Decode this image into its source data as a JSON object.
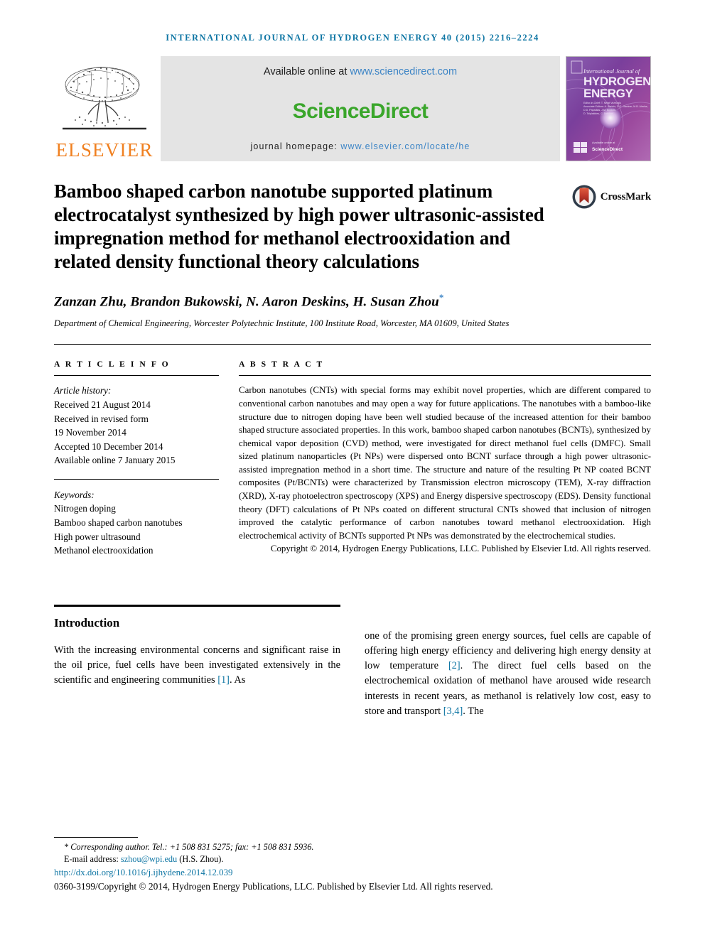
{
  "running_head": "INTERNATIONAL JOURNAL OF HYDROGEN ENERGY 40 (2015) 2216–2224",
  "masthead": {
    "publisher_name": "ELSEVIER",
    "available_prefix": "Available online at ",
    "available_link": "www.sciencedirect.com",
    "sciencedirect_word": "ScienceDirect",
    "homepage_prefix": "journal homepage: ",
    "homepage_link": "www.elsevier.com/locate/he",
    "cover": {
      "line1": "International Journal of",
      "line2": "HYDROGEN",
      "line3": "ENERGY",
      "editors_block": "Editor-in-Chief: T. Nejat Veziroglu\nAssociate Editors: A. Bartels, D.C. Gardner, M.B. Alecha,\nD.D. Papadias, J.M. Bockris,\nD. Tsiplakides, C. Dutcher",
      "footer_brand": "ScienceDirect"
    }
  },
  "crossmark": {
    "label": "CrossMark"
  },
  "article": {
    "title": "Bamboo shaped carbon nanotube supported platinum electrocatalyst synthesized by high power ultrasonic-assisted impregnation method for methanol electrooxidation and related density functional theory calculations",
    "authors": "Zanzan Zhu, Brandon Bukowski, N. Aaron Deskins, H. Susan Zhou",
    "author_star": "*",
    "affiliation": "Department of Chemical Engineering, Worcester Polytechnic Institute, 100 Institute Road, Worcester, MA 01609, United States"
  },
  "article_info": {
    "heading": "A R T I C L E   I N F O",
    "history_label": "Article history:",
    "history": [
      "Received 21 August 2014",
      "Received in revised form",
      "19 November 2014",
      "Accepted 10 December 2014",
      "Available online 7 January 2015"
    ],
    "keywords_label": "Keywords:",
    "keywords": [
      "Nitrogen doping",
      "Bamboo shaped carbon nanotubes",
      "High power ultrasound",
      "Methanol electrooxidation"
    ]
  },
  "abstract": {
    "heading": "A B S T R A C T",
    "body": "Carbon nanotubes (CNTs) with special forms may exhibit novel properties, which are different compared to conventional carbon nanotubes and may open a way for future applications. The nanotubes with a bamboo-like structure due to nitrogen doping have been well studied because of the increased attention for their bamboo shaped structure associated properties. In this work, bamboo shaped carbon nanotubes (BCNTs), synthesized by chemical vapor deposition (CVD) method, were investigated for direct methanol fuel cells (DMFC). Small sized platinum nanoparticles (Pt NPs) were dispersed onto BCNT surface through a high power ultrasonic-assisted impregnation method in a short time. The structure and nature of the resulting Pt NP coated BCNT composites (Pt/BCNTs) were characterized by Transmission electron microscopy (TEM), X-ray diffraction (XRD), X-ray photoelectron spectroscopy (XPS) and Energy dispersive spectroscopy (EDS). Density functional theory (DFT) calculations of Pt NPs coated on different structural CNTs showed that inclusion of nitrogen improved the catalytic performance of carbon nanotubes toward methanol electrooxidation. High electrochemical activity of BCNTs supported Pt NPs was demonstrated by the electrochemical studies.",
    "copyright": "Copyright © 2014, Hydrogen Energy Publications, LLC. Published by Elsevier Ltd. All rights reserved."
  },
  "introduction": {
    "heading": "Introduction",
    "col1_part1": "With the increasing environmental concerns and significant raise in the oil price, fuel cells have been investigated extensively in the scientific and engineering communities ",
    "col1_cite1": "[1]",
    "col1_part2": ". As",
    "col2_part1": "one of the promising green energy sources, fuel cells are capable of offering high energy efficiency and delivering high energy density at low temperature ",
    "col2_cite1": "[2]",
    "col2_part2": ". The direct fuel cells based on the electrochemical oxidation of methanol have aroused wide research interests in recent years, as methanol is relatively low cost, easy to store and transport ",
    "col2_cite2": "[3,4]",
    "col2_part3": ". The"
  },
  "footnote": {
    "corresponding": "* Corresponding author. Tel.: +1 508 831 5275; fax: +1 508 831 5936.",
    "email_label": "E-mail address: ",
    "email_link": "szhou@wpi.edu",
    "email_suffix": " (H.S. Zhou).",
    "doi": "http://dx.doi.org/10.1016/j.ijhydene.2014.12.039",
    "issn_line": "0360-3199/Copyright © 2014, Hydrogen Energy Publications, LLC. Published by Elsevier Ltd. All rights reserved."
  },
  "colors": {
    "link_blue": "#0f76a4",
    "sciencedirect_green": "#3aa62b",
    "elsevier_orange": "#f08020",
    "banner_gray": "#e4e4e4",
    "crossmark_red": "#c0392b"
  }
}
